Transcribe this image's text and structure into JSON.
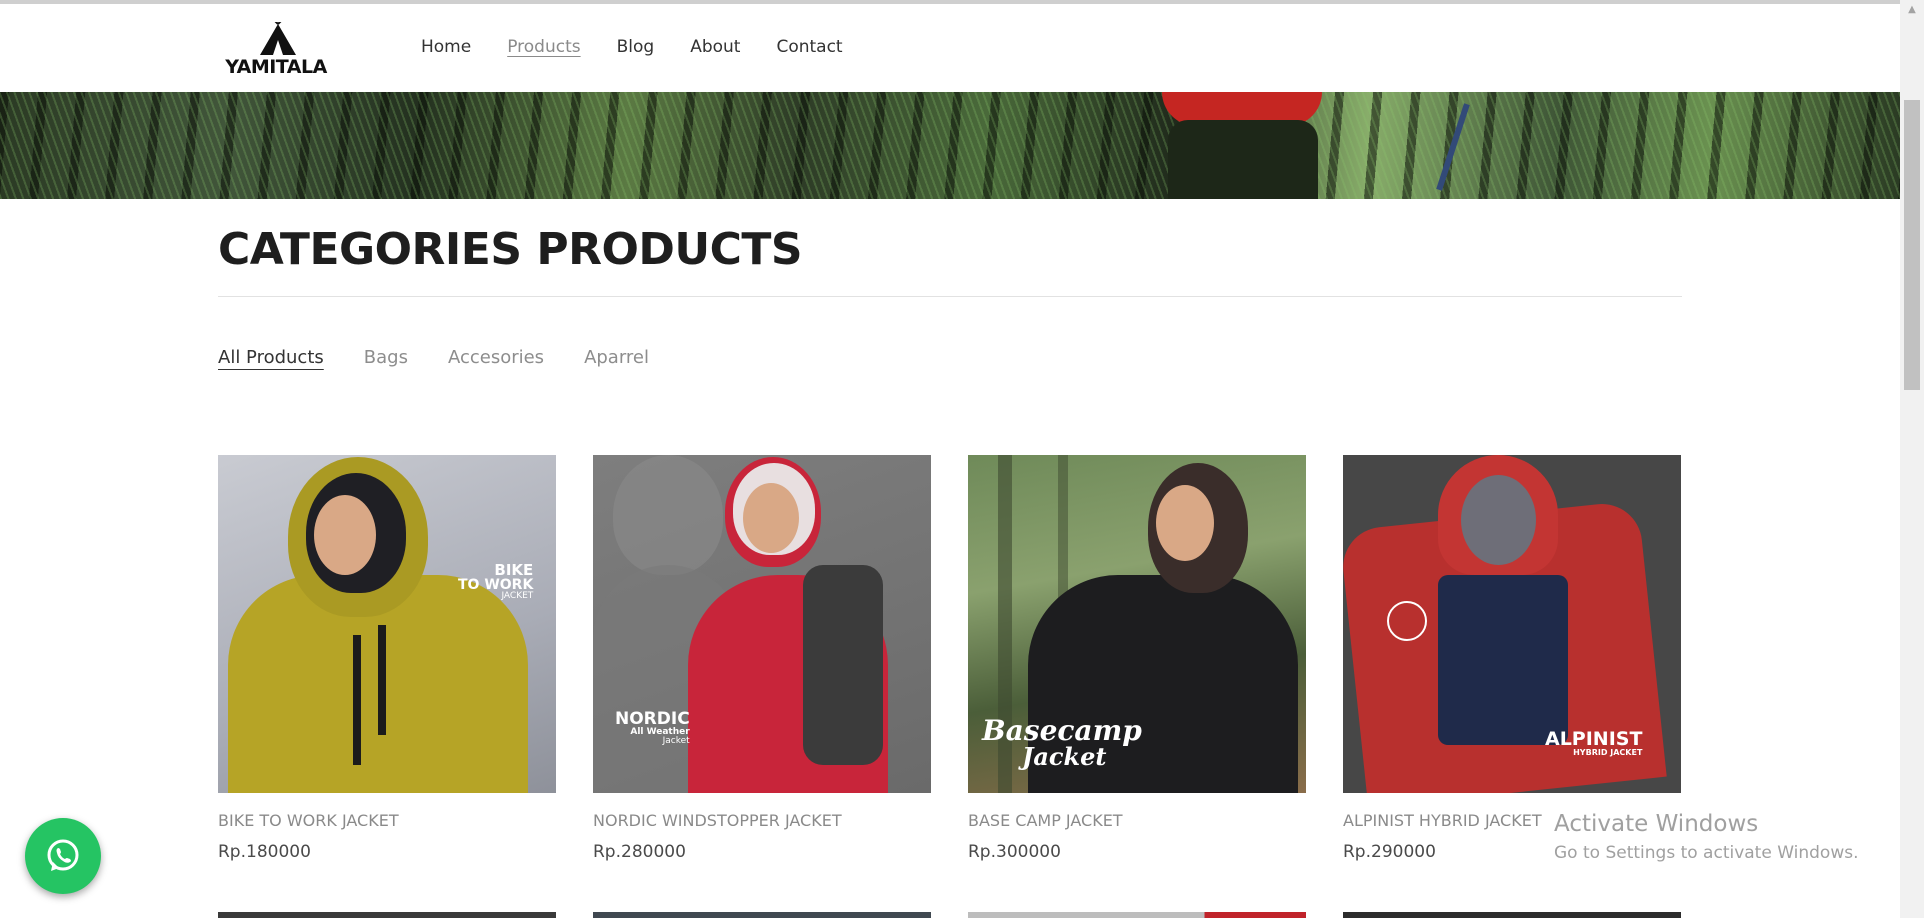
{
  "header": {
    "logo_text": "YAMITALA",
    "nav": [
      {
        "label": "Home",
        "active": false
      },
      {
        "label": "Products",
        "active": true
      },
      {
        "label": "Blog",
        "active": false
      },
      {
        "label": "About",
        "active": false
      },
      {
        "label": "Contact",
        "active": false
      }
    ]
  },
  "section": {
    "title": "CATEGORIES PRODUCTS"
  },
  "filters": [
    {
      "label": "All Products",
      "active": true
    },
    {
      "label": "Bags",
      "active": false
    },
    {
      "label": "Accesories",
      "active": false
    },
    {
      "label": "Aparrel",
      "active": false
    }
  ],
  "products": [
    {
      "name": "BIKE TO WORK JACKET",
      "price": "Rp.180000",
      "image_text": [
        "BIKE",
        "TO WORK",
        "JACKET"
      ]
    },
    {
      "name": "NORDIC WINDSTOPPER JACKET",
      "price": "Rp.280000",
      "image_text": [
        "NORDIC",
        "All Weather",
        "Jacket"
      ]
    },
    {
      "name": "BASE CAMP JACKET",
      "price": "Rp.300000",
      "image_text": [
        "Basecamp",
        "Jacket"
      ]
    },
    {
      "name": "ALPINIST HYBRID JACKET",
      "price": "Rp.290000",
      "image_text": [
        "ALPINIST",
        "HYBRID JACKET"
      ]
    }
  ],
  "whatsapp": {
    "icon": "whatsapp-icon",
    "color": "#25c463"
  },
  "activate_windows": {
    "title": "Activate Windows",
    "subtitle": "Go to Settings to activate Windows."
  }
}
